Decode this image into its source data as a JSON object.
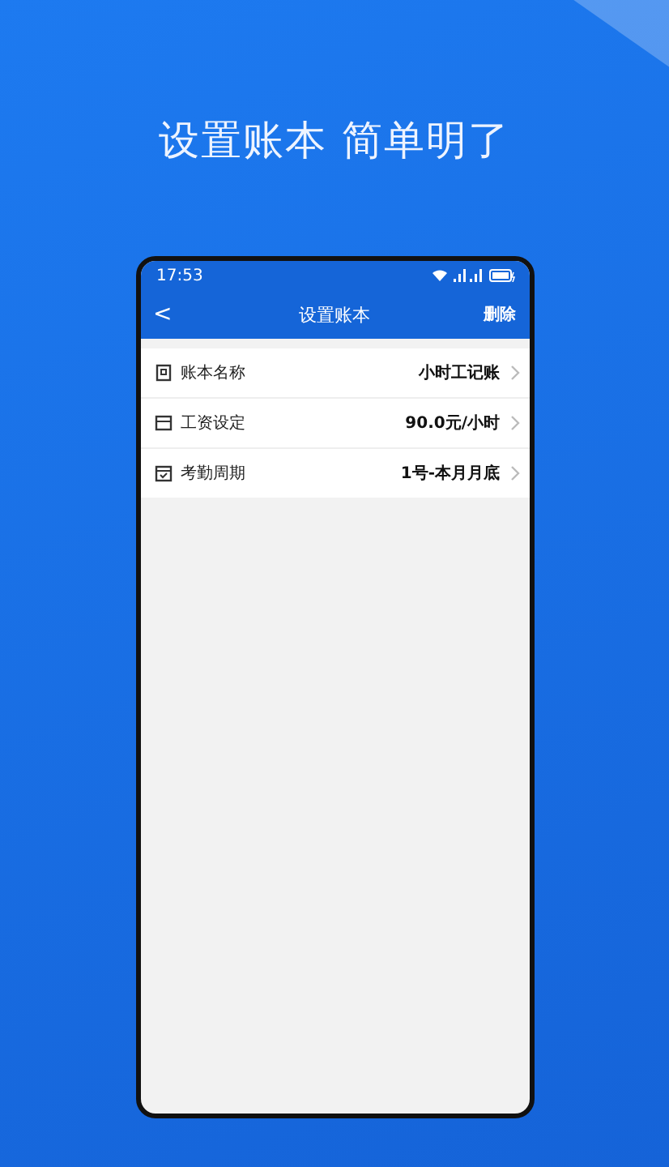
{
  "headline": "设置账本 简单明了",
  "status_bar": {
    "time": "17:53"
  },
  "header": {
    "back": "<",
    "title": "设置账本",
    "action": "删除"
  },
  "rows": [
    {
      "label": "账本名称",
      "value": "小时工记账"
    },
    {
      "label": "工资设定",
      "value": "90.0元/小时"
    },
    {
      "label": "考勤周期",
      "value": "1号-本月月底"
    }
  ]
}
